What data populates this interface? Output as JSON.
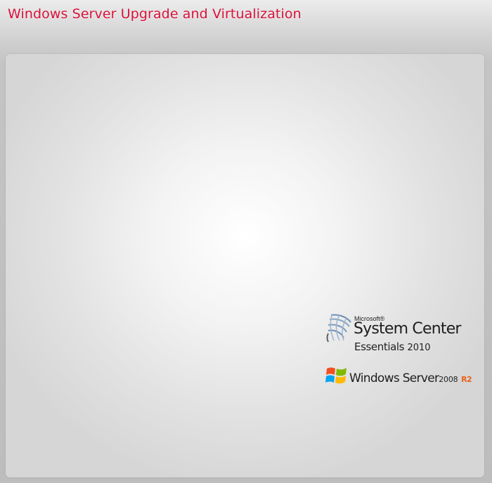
{
  "header": {
    "title": "Windows Server Upgrade and Virtualization"
  },
  "logos": {
    "system_center": {
      "icon": "system-center-swirl-icon",
      "vendor": "Microsoft®",
      "product": "System Center",
      "edition": "Essentials",
      "year": "2010"
    },
    "windows_server": {
      "icon": "windows-flag-icon",
      "product": "Windows Server",
      "year": "2008",
      "release": "R2"
    }
  },
  "colors": {
    "title": "#d8103a",
    "r2_accent": "#e8621a"
  }
}
